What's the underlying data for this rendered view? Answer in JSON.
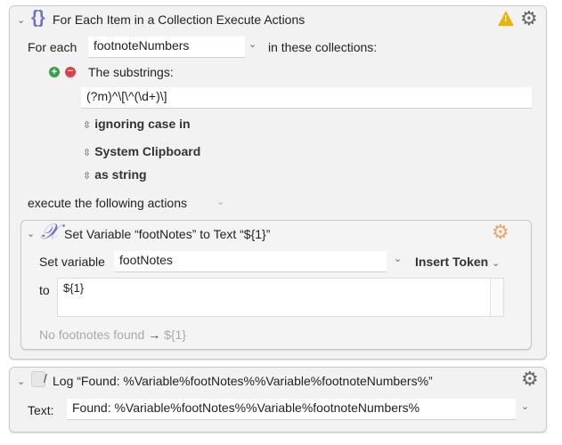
{
  "for_each_action": {
    "title": "For Each Item in a Collection Execute Actions",
    "icon": "braces-icon",
    "warning_icon": "warning-icon",
    "gear_icon": "gear-clock-icon",
    "for_each_label": "For each",
    "variable_value": "footnoteNumbers",
    "in_collections_label": "in these collections:",
    "substrings_label": "The substrings:",
    "regex_value": "(?m)^\\[\\^(\\d+)\\]",
    "case_option": "ignoring case in",
    "source_option": "System Clipboard",
    "format_option": "as string",
    "execute_label": "execute the following actions"
  },
  "set_variable_action": {
    "title": "Set Variable “footNotes” to Text “${1}”",
    "icon": "variable-x-icon",
    "gear_icon": "gear-icon",
    "set_variable_label": "Set variable",
    "variable_value": "footNotes",
    "insert_token_label": "Insert Token",
    "to_label": "to",
    "text_value": "${1}",
    "note_text": "No footnotes found",
    "note_arrow": "→",
    "note_value": "${1}"
  },
  "log_action": {
    "title": "Log “Found: %Variable%footNotes%%Variable%footnoteNumbers%”",
    "icon": "log-icon",
    "gear_icon": "gear-icon",
    "text_label": "Text:",
    "text_value": "Found: %Variable%footNotes%%Variable%footnoteNumbers%"
  },
  "colors": {
    "accent_purple": "#6b6fd6",
    "warning": "#e7b416",
    "add_green": "#3aa04a",
    "remove_red": "#d8434b"
  }
}
